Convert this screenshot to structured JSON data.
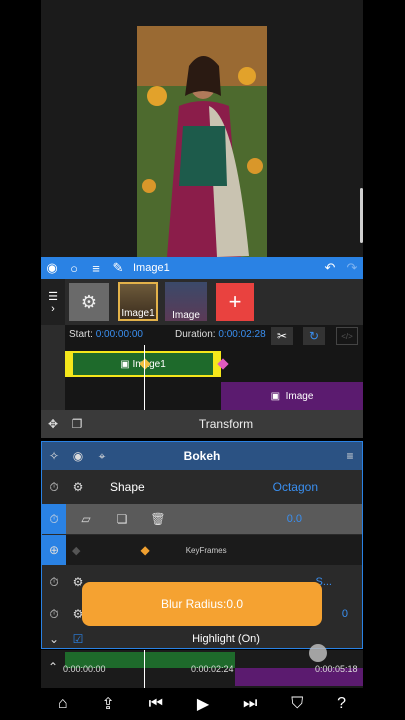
{
  "project": {
    "title": "Image1"
  },
  "layers": {
    "thumb1_label": "Image1",
    "thumb2_label": "Image",
    "add_label": "+"
  },
  "timeline": {
    "start_label": "Start:",
    "start_value": "0:00:00:00",
    "duration_label": "Duration:",
    "duration_value": "0:00:02:28",
    "clip1_label": "Image1",
    "clip2_label": "Image"
  },
  "transform": {
    "title": "Transform"
  },
  "effect": {
    "title": "Bokeh",
    "shape_label": "Shape",
    "shape_value": "Octagon",
    "keyframe_value": "0.0",
    "keyframes_label": "KeyFrames",
    "stub1_value": "S...",
    "stub2_value": "0",
    "highlight_label": "Highlight (On)",
    "toast": "Blur Radius:0.0"
  },
  "scrubber": {
    "t0": "0:00:00:00",
    "t1": "0:00:02:24",
    "t2": "0:00:05:18"
  },
  "colors": {
    "accent": "#2a82e4",
    "clip": "#1e6a2b",
    "highlight": "#f5a231"
  }
}
